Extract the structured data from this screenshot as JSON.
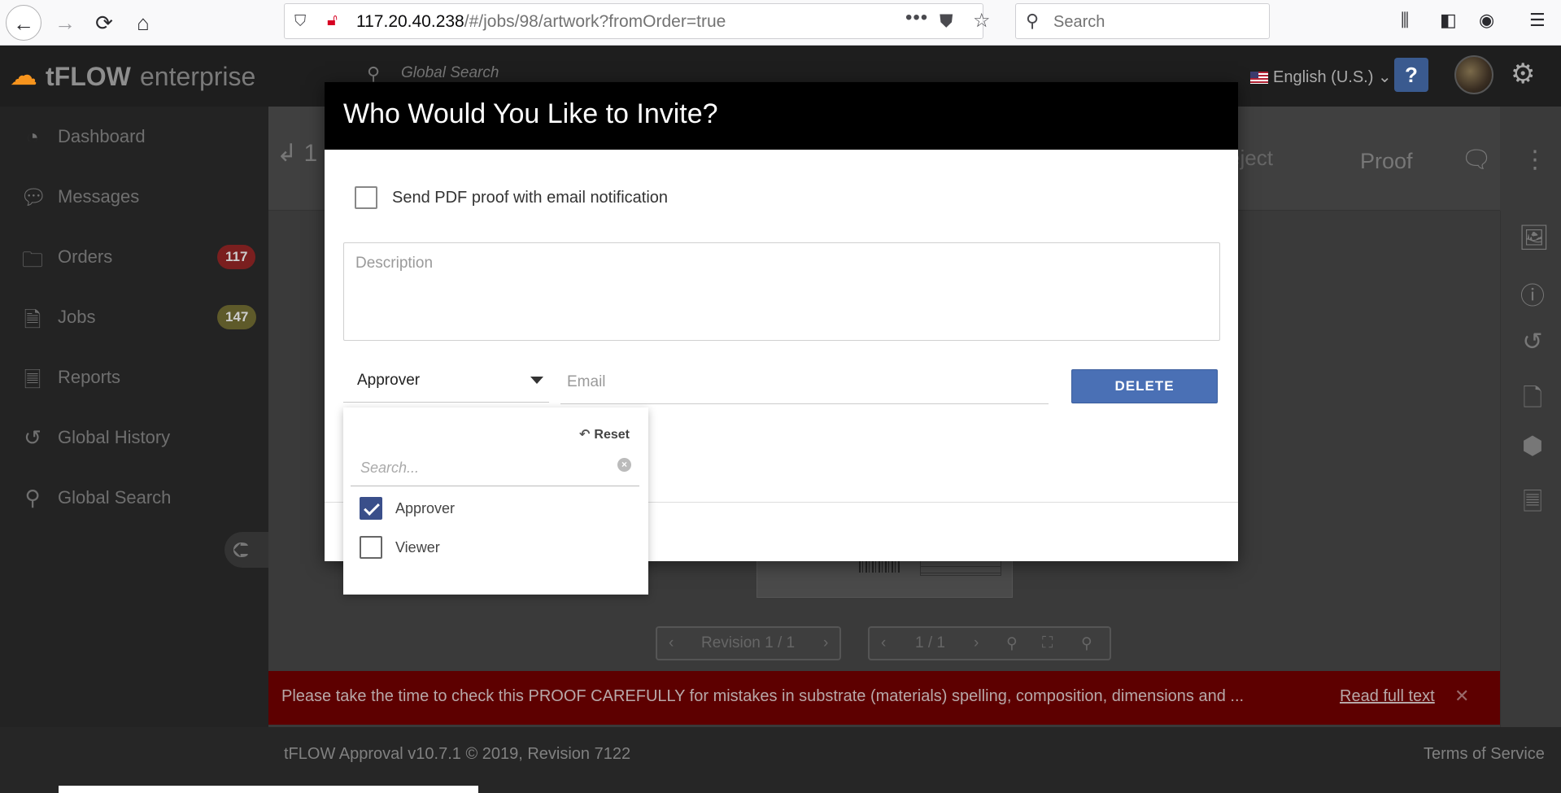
{
  "browser": {
    "url_host": "117.20.40.238",
    "url_path": "/#/jobs/98/artwork?fromOrder=true",
    "search_placeholder": "Search"
  },
  "header": {
    "logo_brand": "tFLOW",
    "logo_suffix": "enterprise",
    "global_search_placeholder": "Global Search",
    "language": "English (U.S.)"
  },
  "sidebar": {
    "items": [
      {
        "label": "Dashboard"
      },
      {
        "label": "Messages"
      },
      {
        "label": "Orders",
        "badge": "117",
        "badge_color": "#7a1f1f"
      },
      {
        "label": "Jobs",
        "badge": "147",
        "badge_color": "#5e5a2a"
      },
      {
        "label": "Reports"
      },
      {
        "label": "Global History"
      },
      {
        "label": "Global Search"
      }
    ]
  },
  "main": {
    "job_prefix": "1",
    "reject_label": "eject",
    "proof_label": "Proof",
    "revision_text": "Revision 1 / 1",
    "page_text": "1 / 1",
    "notice_text": "Please take the time to check this PROOF CAREFULLY for mistakes in substrate (materials) spelling, composition, dimensions and ...",
    "notice_link": "Read full text"
  },
  "footer": {
    "copyright": "tFLOW Approval v10.7.1 © 2019, Revision 7122",
    "terms": "Terms of Service"
  },
  "modal": {
    "title": "Who Would You Like to Invite?",
    "pdf_checkbox_label": "Send PDF proof with email notification",
    "pdf_checked": false,
    "description_placeholder": "Description",
    "role_selected": "Approver",
    "email_placeholder": "Email",
    "delete_label": "DELETE"
  },
  "role_dropdown": {
    "reset_label": "Reset",
    "search_placeholder": "Search...",
    "options": [
      {
        "label": "Approver",
        "checked": true
      },
      {
        "label": "Viewer",
        "checked": false
      }
    ]
  },
  "colors": {
    "accent_blue": "#4a70b5",
    "check_blue": "#3a4f8a",
    "notice_red": "#5d0000",
    "logo_orange": "#f7941d"
  }
}
